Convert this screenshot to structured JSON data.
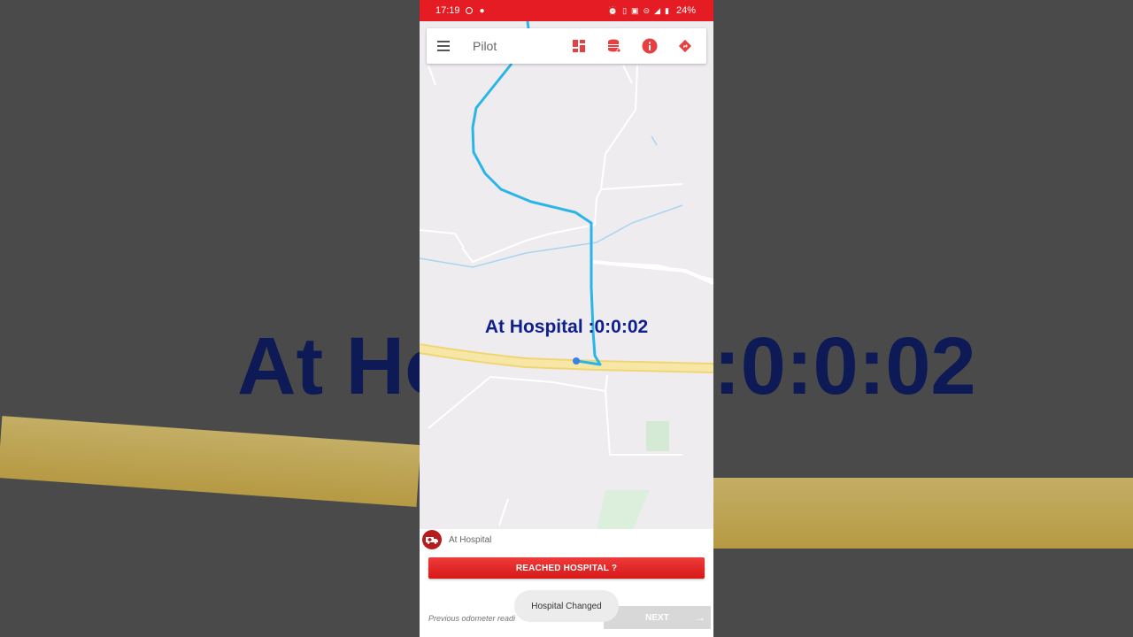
{
  "status_bar": {
    "time": "17:19",
    "battery": "24%"
  },
  "toolbar": {
    "title": "Pilot",
    "icons": [
      "dashboard-icon",
      "database-icon",
      "info-icon",
      "directions-icon"
    ]
  },
  "map": {
    "overlay_text": "At Hospital :0:0:02"
  },
  "background": {
    "left_text": "At Ho",
    "right_text": ":0:0:02"
  },
  "bottom_panel": {
    "status_label": "At Hospital",
    "reached_button_label": "REACHED HOSPITAL ?",
    "odometer_placeholder": "Previous odometer readi",
    "next_button_label": "NEXT"
  },
  "toast": {
    "message": "Hospital Changed"
  },
  "colors": {
    "accent": "#e51c23",
    "route": "#29b6e6",
    "timer_text": "#0f1f8c"
  }
}
